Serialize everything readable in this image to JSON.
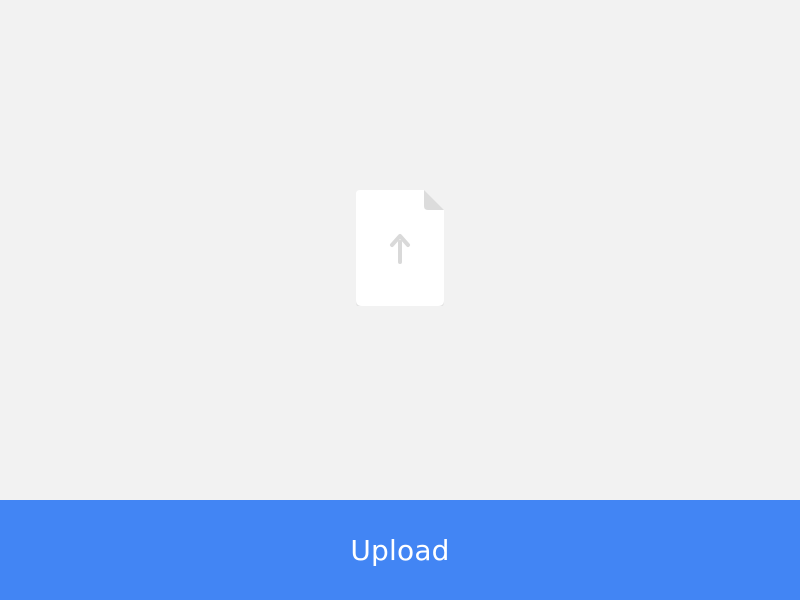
{
  "upload_button": {
    "label": "Upload"
  },
  "icons": {
    "file": "file-upload-icon",
    "arrow": "arrow-up-icon"
  },
  "colors": {
    "background": "#f2f2f2",
    "card": "#ffffff",
    "card_fold": "#dcdcdc",
    "arrow": "#d9d9d9",
    "button": "#4285f4",
    "button_text": "#ffffff"
  }
}
